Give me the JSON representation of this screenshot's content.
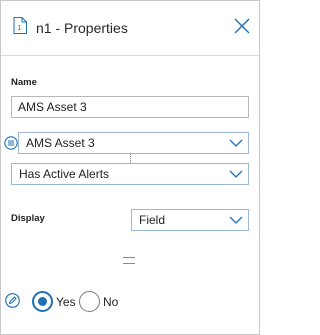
{
  "header": {
    "title": "n1 - Properties",
    "icon": "document-icon",
    "close_icon": "close-icon"
  },
  "name_section": {
    "label": "Name",
    "value": "AMS Asset 3"
  },
  "condition": {
    "source_select": "AMS Asset 3",
    "field_select": "Has Active Alerts",
    "list_icon": "list-icon"
  },
  "display": {
    "label": "Display",
    "select": "Field"
  },
  "operator": {
    "icon": "equals-icon"
  },
  "value_options": {
    "edit_icon": "pencil-icon",
    "options": [
      {
        "label": "Yes",
        "selected": true
      },
      {
        "label": "No",
        "selected": false
      }
    ]
  },
  "colors": {
    "accent": "#1d6fb8",
    "select_border": "#9db7d6"
  }
}
